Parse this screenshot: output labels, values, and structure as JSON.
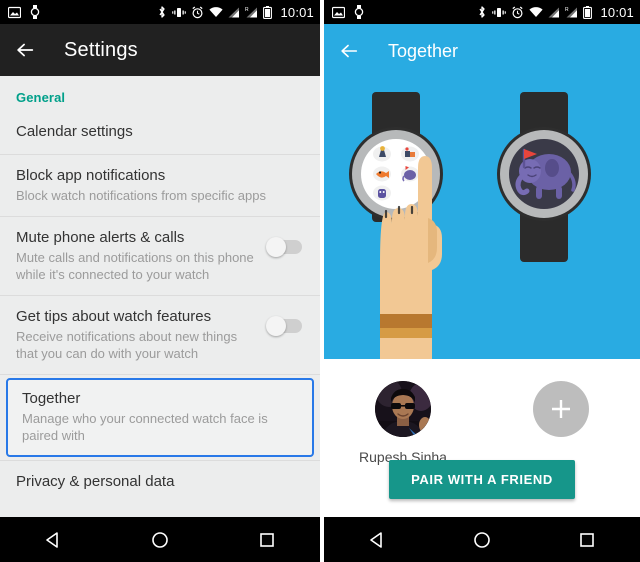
{
  "status_bar": {
    "time": "10:01",
    "left_icons": [
      "image-icon",
      "watch-icon"
    ],
    "right_icons": [
      "bluetooth-icon",
      "vibrate-icon",
      "alarm-icon",
      "wifi-icon",
      "signal-icon",
      "roaming-signal-icon",
      "battery-icon"
    ]
  },
  "colors": {
    "accent_teal": "#00a08a",
    "header_dark": "#212121",
    "header_blue": "#29abe2",
    "highlight_blue": "#2979e8",
    "button_teal": "#16968a",
    "list_bg": "#eceded"
  },
  "left_screen": {
    "app_bar": {
      "back_label": "back-arrow",
      "title": "Settings"
    },
    "section_header": "General",
    "items": [
      {
        "title": "Calendar settings",
        "subtitle": "",
        "toggle": null,
        "highlighted": false
      },
      {
        "title": "Block app notifications",
        "subtitle": "Block watch notifications from specific apps",
        "toggle": null,
        "highlighted": false
      },
      {
        "title": "Mute phone alerts & calls",
        "subtitle": "Mute calls and notifications on this phone while it's connected to your watch",
        "toggle": "off",
        "highlighted": false
      },
      {
        "title": "Get tips about watch features",
        "subtitle": "Receive notifications about new things that you can do with your watch",
        "toggle": "off",
        "highlighted": false
      },
      {
        "title": "Together",
        "subtitle": "Manage who your connected watch face is paired with",
        "toggle": null,
        "highlighted": true
      },
      {
        "title": "Privacy & personal data",
        "subtitle": "",
        "toggle": null,
        "highlighted": false
      }
    ]
  },
  "right_screen": {
    "app_bar": {
      "back_label": "back-arrow",
      "title": "Together"
    },
    "illustration": {
      "description": "hand tapping a white watch face with stickers beside a dark watch face showing a purple elephant with a red flag"
    },
    "people": [
      {
        "name": "Rupesh Sinha",
        "type": "avatar-photo"
      },
      {
        "name": "",
        "type": "add-person"
      }
    ],
    "pair_button": "PAIR WITH A FRIEND"
  },
  "nav_bar": {
    "buttons": [
      "back-triangle-icon",
      "home-circle-icon",
      "recents-square-icon"
    ]
  }
}
